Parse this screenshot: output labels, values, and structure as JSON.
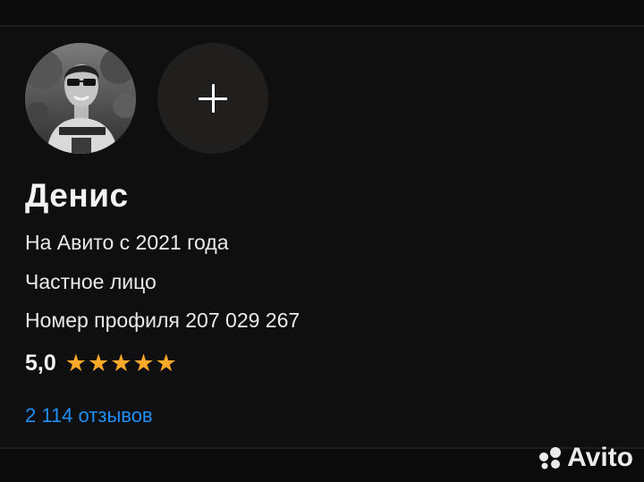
{
  "profile": {
    "name": "Денис",
    "member_since": "На Авито с 2021 года",
    "seller_type": "Частное лицо",
    "profile_number": "Номер профиля 207 029 267",
    "rating": "5,0",
    "stars": 5,
    "reviews": "2 114 отзывов"
  },
  "watermark": {
    "text": "Avito"
  },
  "colors": {
    "background": "#0b0b0c",
    "star": "#ffa928",
    "link": "#1f8ff5",
    "add_button": "#211f1e"
  },
  "icons": {
    "add_photo": "plus-icon",
    "rating": "star-icon",
    "logo": "avito-logo"
  }
}
